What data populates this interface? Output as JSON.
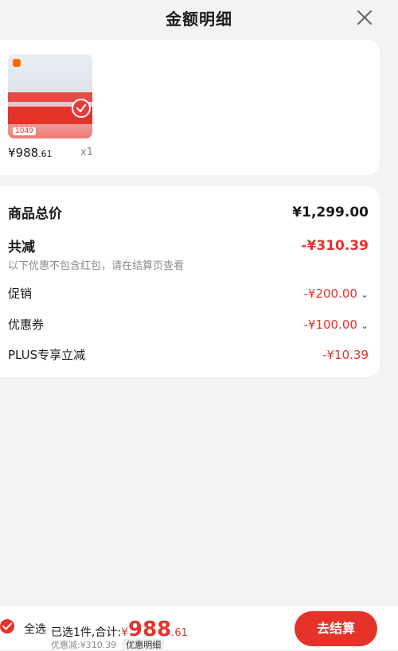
{
  "header": {
    "title": "金额明细"
  },
  "product": {
    "price_main": "¥988",
    "price_cents": ".61",
    "quantity": "x1",
    "image_badge": "1049"
  },
  "breakdown": {
    "total_label": "商品总价",
    "total_value": "¥1,299.00",
    "reduce_label": "共减",
    "reduce_value": "-¥310.39",
    "note": "以下优惠不包含红包，请在结算页查看",
    "items": [
      {
        "label": "促销",
        "value": "-¥200.00"
      },
      {
        "label": "优惠券",
        "value": "-¥100.00"
      },
      {
        "label": "PLUS专享立减",
        "value": "-¥10.39"
      }
    ]
  },
  "bottom": {
    "select_all": "全选",
    "selected_text": "已选1件,合计:",
    "total_symbol": "¥",
    "total_main": "988",
    "total_cents": ".61",
    "discount_text": "优惠减:¥310.39",
    "detail_label": "优惠明细",
    "checkout_label": "去结算"
  },
  "colors": {
    "accent": "#e5332a",
    "background": "#f3f3f3",
    "card": "#ffffff"
  }
}
